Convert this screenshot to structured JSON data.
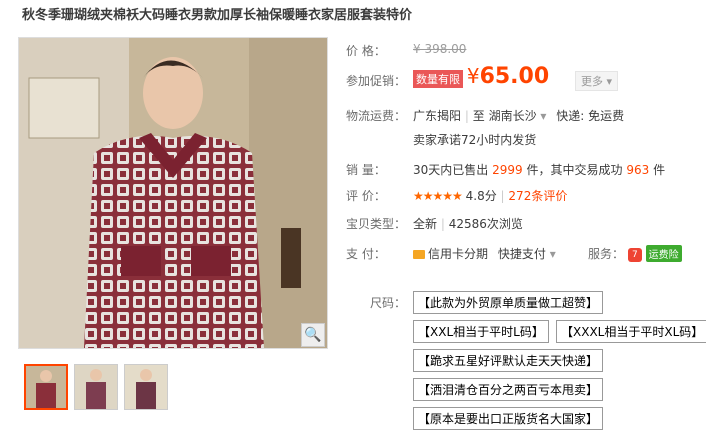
{
  "title": "秋冬季珊瑚绒夹棉袄大码睡衣男款加厚长袖保暖睡衣家居服套装特价",
  "price": {
    "label": "价    格：",
    "value": "¥ 398.00"
  },
  "promo": {
    "label": "参加促销：",
    "badge": "数量有限",
    "currency": "¥",
    "value": "65.00",
    "more": "更多"
  },
  "shipping": {
    "label": "物流运费：",
    "from": "广东揭阳",
    "to_word": "至",
    "dest": "湖南长沙",
    "fee": "快递: 免运费",
    "promise": "卖家承诺72小时内发货"
  },
  "sales": {
    "label": "销    量：",
    "prefix": "30天内已售出",
    "count": "2999",
    "mid": "件，其中交易成功",
    "success": "963",
    "suffix": "件"
  },
  "rating": {
    "label": "评    价：",
    "stars": "★★★★★",
    "score": "4.8分",
    "count": "272条评价"
  },
  "item_type": {
    "label": "宝贝类型：",
    "condition": "全新",
    "views": "42586次浏览"
  },
  "payment": {
    "label": "支    付：",
    "credit": "信用卡分期",
    "quick": "快捷支付",
    "service_label": "服务：",
    "service_badge": "运费险"
  },
  "size": {
    "label": "尺码：",
    "options": [
      "【此款为外贸原单质量做工超赞】",
      "【XXL相当于平时L码】",
      "【XXXL相当于平时XL码】",
      "【跪求五星好评默认走天天快递】",
      "【洒泪清仓百分之两百亏本甩卖】",
      "【原本是要出口正版货名大国家】"
    ]
  },
  "colors": {
    "orange": "#ff4400",
    "green": "#3eab2f",
    "badge_red": "#ea5757"
  }
}
